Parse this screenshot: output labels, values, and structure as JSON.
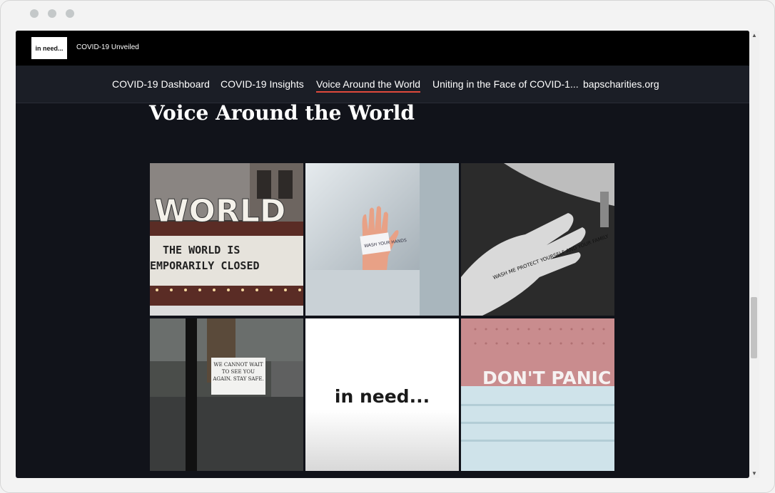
{
  "site": {
    "logo_text": "in need...",
    "title": "COVID-19 Unveiled"
  },
  "nav": {
    "items": [
      {
        "label": "COVID-19 Dashboard"
      },
      {
        "label": "COVID-19 Insights"
      },
      {
        "label": "Voice Around the World"
      },
      {
        "label": "Uniting in the Face of COVID-1..."
      },
      {
        "label": "bapscharities.org"
      }
    ],
    "active_index": 2
  },
  "page": {
    "heading": "Voice Around the World"
  },
  "gallery": {
    "tiles": [
      {
        "marquee_top": "WORLD",
        "line1": "THE WORLD IS",
        "line2": "EMPORARILY CLOSED"
      },
      {
        "hand_text": "WASH YOUR HANDS"
      },
      {
        "palm_text": "WASH ME PROTECT YOURSELF AND YOUR FAMILY"
      },
      {
        "sign_text": "WE CANNOT WAIT TO SEE YOU AGAIN. STAY SAFE."
      },
      {
        "brand_text": "in need..."
      },
      {
        "board_text": "DON'T PANIC"
      }
    ]
  },
  "colors": {
    "background": "#11131a",
    "nav_underline": "#e0493b",
    "topbar": "#000000"
  }
}
